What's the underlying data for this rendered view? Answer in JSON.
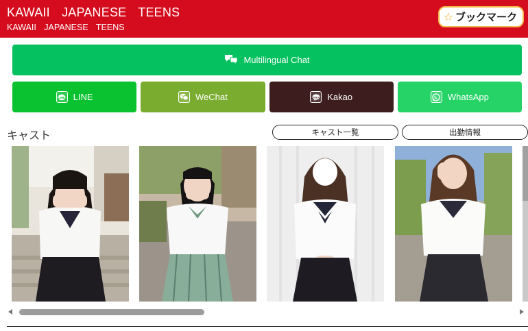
{
  "header": {
    "title": "KAWAII JAPANESE TEENS",
    "subtitle": "KAWAII JAPANESE TEENS",
    "bookmark_label": "ブックマーク",
    "bookmark_icon": "star-outline-icon",
    "bg_color": "#d40c1d"
  },
  "chat": {
    "label": "Multilingual Chat",
    "icon": "chat-bubbles-icon",
    "color": "#06c15f"
  },
  "messengers": [
    {
      "label": "LINE",
      "icon": "line-icon",
      "color": "#0ac22f"
    },
    {
      "label": "WeChat",
      "icon": "wechat-icon",
      "color": "#7aac2f"
    },
    {
      "label": "Kakao",
      "icon": "kakao-icon",
      "color": "#3d1d1e"
    },
    {
      "label": "WhatsApp",
      "icon": "whatsapp-icon",
      "color": "#25d366"
    }
  ],
  "cast": {
    "title": "キャスト",
    "list_button": "キャスト一覧",
    "schedule_button": "出勤情報"
  }
}
